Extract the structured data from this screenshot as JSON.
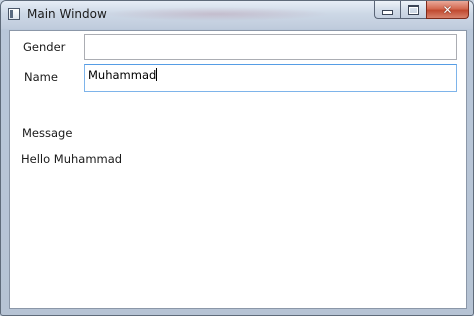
{
  "window": {
    "title": "Main Window",
    "close_glyph": "✕"
  },
  "form": {
    "gender": {
      "label": "Gender",
      "value": ""
    },
    "name": {
      "label": "Name",
      "value": "Muhammad"
    },
    "message_label": "Message",
    "message_text": "Hello Muhammad"
  },
  "icons": {
    "app": "window-app-icon",
    "minimize": "minimize-icon",
    "maximize": "maximize-icon",
    "close": "close-icon"
  },
  "colors": {
    "close_button": "#c75a40",
    "focus_border": "#569de5",
    "textbox_border": "#abadb3"
  }
}
